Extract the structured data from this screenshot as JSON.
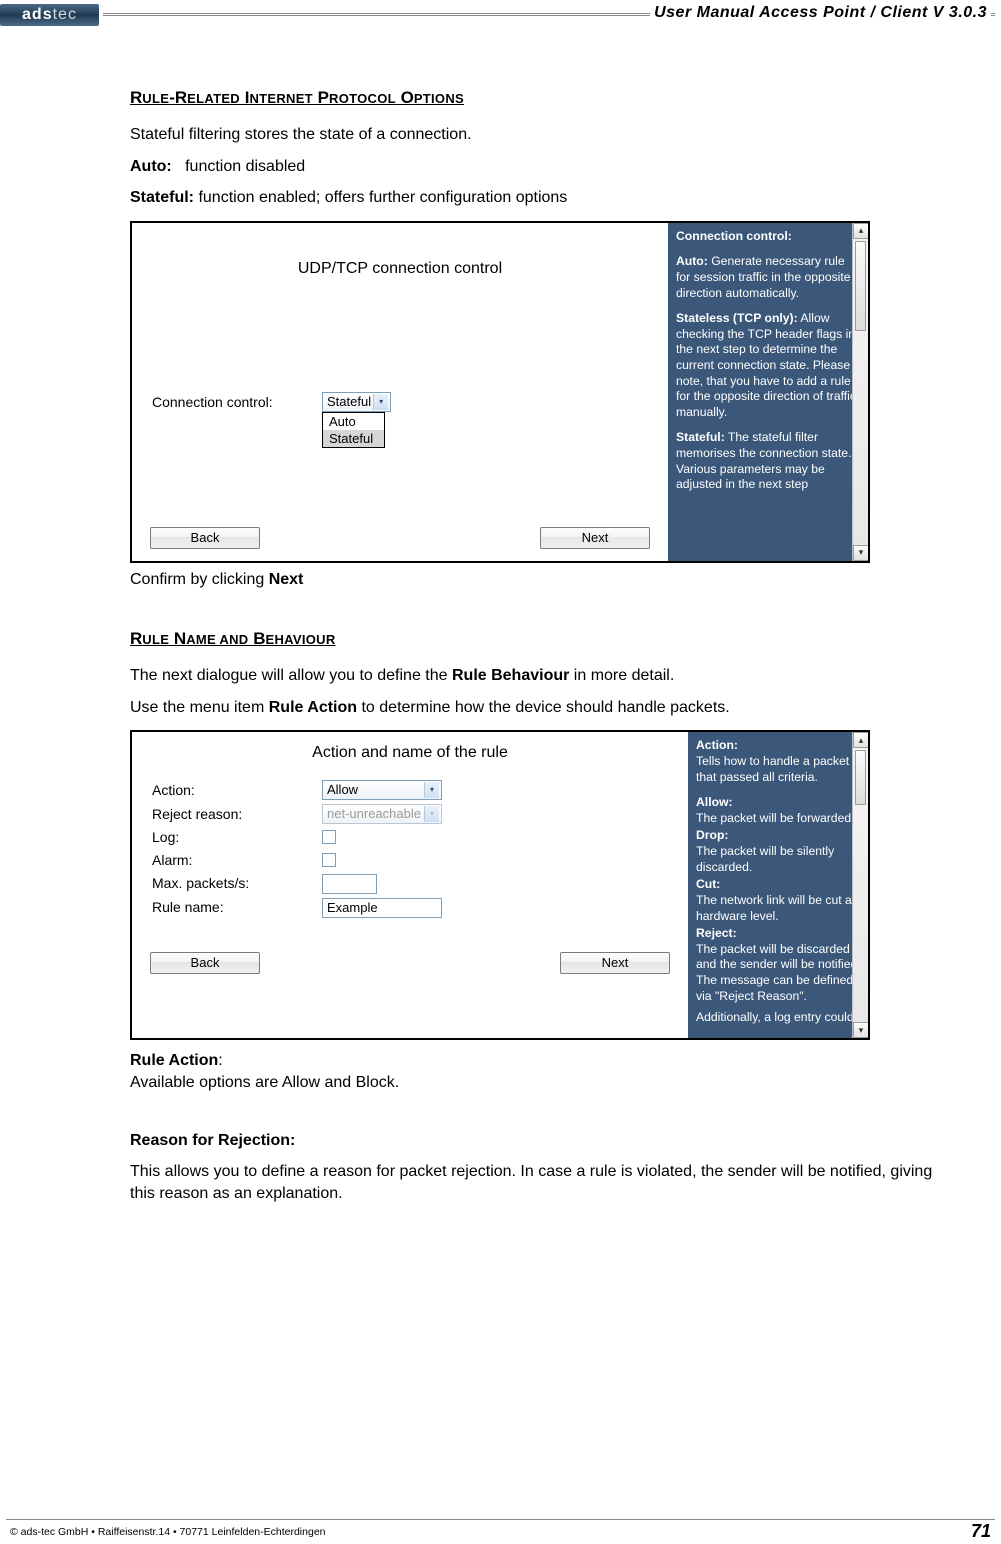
{
  "header": {
    "logo_a": "ads",
    "logo_b": "tec",
    "title": "User Manual Access  Point / Client V 3.0.3"
  },
  "section1": {
    "heading_parts": [
      "R",
      "ULE",
      "-R",
      "ELATED",
      " I",
      "NTERNET",
      " P",
      "ROTOCOL",
      " O",
      "PTIONS"
    ],
    "p1": "Stateful filtering stores the state of a connection.",
    "auto_label": "Auto:",
    "auto_text": "function disabled",
    "stateful_label": "Stateful:",
    "stateful_text": "function enabled; offers further configuration options",
    "confirm_pre": "Confirm by clicking ",
    "confirm_bold": "Next"
  },
  "shot1": {
    "title": "UDP/TCP connection control",
    "label_cc": "Connection control:",
    "select_value": "Stateful",
    "option_auto": "Auto",
    "option_stateful": "Stateful",
    "btn_back": "Back",
    "btn_next": "Next",
    "help_cc_h": "Connection control:",
    "help_auto_h": "Auto:",
    "help_auto_t": " Generate necessary rule for session traffic in the opposite direction automatically.",
    "help_sl_h": "Stateless (TCP only):",
    "help_sl_t": " Allow checking the TCP header flags in the next step to determine the current connection state. Please note, that you have to add a rule for the opposite direction of traffic manually.",
    "help_sf_h": "Stateful:",
    "help_sf_t": " The stateful filter memorises the connection state. Various parameters may be adjusted in the next step"
  },
  "section2": {
    "heading_parts": [
      "R",
      "ULE",
      " N",
      "AME AND",
      " B",
      "EHAVIOUR"
    ],
    "p1_pre": "The next dialogue will allow you to define the ",
    "p1_bold": "Rule Behaviour",
    "p1_post": " in more detail.",
    "p2_pre": "Use the menu item ",
    "p2_bold": "Rule Action",
    "p2_post": " to determine how the device should handle packets."
  },
  "shot2": {
    "title": "Action and name of the rule",
    "label_action": "Action:",
    "action_value": "Allow",
    "label_reject": "Reject reason:",
    "reject_value": "net-unreachable",
    "label_log": "Log:",
    "label_alarm": "Alarm:",
    "label_max": "Max. packets/s:",
    "max_value": "",
    "label_rulename": "Rule name:",
    "rulename_value": "Example",
    "btn_back": "Back",
    "btn_next": "Next",
    "help_action_h": "Action:",
    "help_action_t": "Tells how to handle a packet that passed all criteria.",
    "help_allow_h": "Allow:",
    "help_allow_t": "The packet will be forwarded.",
    "help_drop_h": "Drop:",
    "help_drop_t": "The packet will be silently discarded.",
    "help_cut_h": "Cut:",
    "help_cut_t": "The network link will be cut at hardware level.",
    "help_reject_h": "Reject:",
    "help_reject_t": "The packet will be discarded and the sender will be notified. The message can be defined via \"Reject Reason\".",
    "help_add_t": "Additionally, a log entry could"
  },
  "section3": {
    "ra_bold": "Rule Action",
    "ra_colon": ":",
    "ra_text": "Available options are Allow and Block.",
    "rr_head": "Reason for Rejection:",
    "rr_text": "This allows you to define a reason for packet rejection. In case a rule is violated, the sender will be notified, giving this reason as an explanation."
  },
  "footer": {
    "left": "© ads-tec GmbH • Raiffeisenstr.14 • 70771 Leinfelden-Echterdingen",
    "page": "71"
  }
}
